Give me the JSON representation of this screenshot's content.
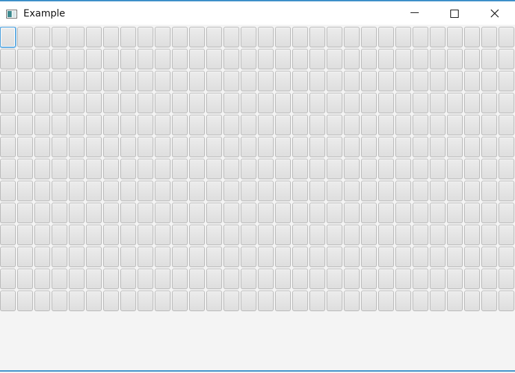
{
  "window": {
    "title": "Example",
    "icons": {
      "app": "window-app-icon",
      "minimize": "minimize-icon",
      "maximize": "maximize-icon",
      "close": "close-icon"
    }
  },
  "grid": {
    "rows": 13,
    "columns": 30,
    "focused_cell": {
      "row": 0,
      "column": 0
    }
  },
  "colors": {
    "accent": "#3c8fc9",
    "background": "#f4f4f4",
    "button_face": "#e4e4e4"
  }
}
